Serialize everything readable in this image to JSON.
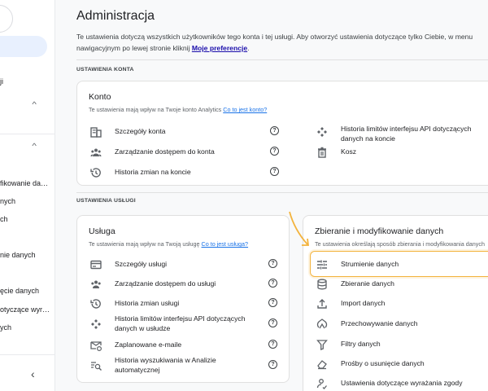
{
  "sidebar": {
    "items": [
      {
        "label": "ji"
      },
      {
        "label": "fikowanie da…"
      },
      {
        "label": "nych"
      },
      {
        "label": "ch"
      },
      {
        "label": "nie danych"
      },
      {
        "label": "ęcie danych"
      },
      {
        "label": "otyczące wyr…"
      },
      {
        "label": "ych"
      }
    ]
  },
  "page": {
    "title": "Administracja",
    "intro_text": "Te ustawienia dotyczą wszystkich użytkowników tego konta i tej usługi. Aby otworzyć ustawienia dotyczące tylko Ciebie, w menu nawigacyjnym po lewej stronie kliknij",
    "intro_link": "Moje preferencje",
    "intro_end": "."
  },
  "account_section": {
    "label": "USTAWIENIA KONTA",
    "card": {
      "title": "Konto",
      "desc": "Te ustawienia mają wpływ na Twoje konto Analytics",
      "desc_link": "Co to jest konto?",
      "left_items": [
        {
          "label": "Szczegóły konta",
          "icon": "building-icon"
        },
        {
          "label": "Zarządzanie dostępem do konta",
          "icon": "people-icon"
        },
        {
          "label": "Historia zmian na koncie",
          "icon": "history-icon"
        }
      ],
      "right_items": [
        {
          "label": "Historia limitów interfejsu API dotyczących danych na koncie",
          "icon": "api-icon"
        },
        {
          "label": "Kosz",
          "icon": "trash-icon"
        }
      ]
    }
  },
  "property_section": {
    "label": "USTAWIENIA USŁUGI",
    "card": {
      "title": "Usługa",
      "desc": "Te ustawienia mają wpływ na Twoją usługę",
      "desc_link": "Co to jest usługa?",
      "items": [
        {
          "label": "Szczegóły usługi",
          "icon": "card-icon"
        },
        {
          "label": "Zarządzanie dostępem do usługi",
          "icon": "people-icon"
        },
        {
          "label": "Historia zmian usługi",
          "icon": "history-icon"
        },
        {
          "label": "Historia limitów interfejsu API dotyczących danych w usłudze",
          "icon": "api-icon"
        },
        {
          "label": "Zaplanowane e-maile",
          "icon": "scheduled-mail-icon"
        },
        {
          "label": "Historia wyszukiwania w Analizie automatycznej",
          "icon": "search-history-icon"
        }
      ]
    },
    "data_card": {
      "title": "Zbieranie i modyfikowanie danych",
      "desc": "Te ustawienia określają sposób zbierania i modyfikowania danych",
      "items": [
        {
          "label": "Strumienie danych",
          "icon": "streams-icon"
        },
        {
          "label": "Zbieranie danych",
          "icon": "database-icon"
        },
        {
          "label": "Import danych",
          "icon": "upload-icon"
        },
        {
          "label": "Przechowywanie danych",
          "icon": "retention-icon"
        },
        {
          "label": "Filtry danych",
          "icon": "filter-icon"
        },
        {
          "label": "Prośby o usunięcie danych",
          "icon": "eraser-icon"
        },
        {
          "label": "Ustawienia dotyczące wyrażania zgody",
          "icon": "consent-icon"
        }
      ]
    }
  },
  "colors": {
    "highlight": "#f3b33d",
    "link": "#1a73e8"
  }
}
